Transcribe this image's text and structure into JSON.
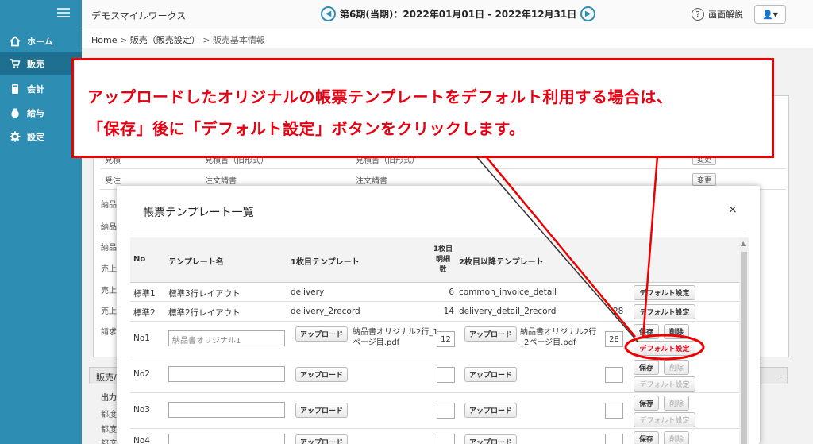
{
  "app": {
    "company": "デモスマイルワークス",
    "period": "第6期(当期)：2022年01月01日 - 2022年12月31日",
    "help_label": "画面解説"
  },
  "sidebar": {
    "items": [
      {
        "label": "ホーム",
        "icon": "home-icon"
      },
      {
        "label": "販売",
        "icon": "cart-icon",
        "active": true
      },
      {
        "label": "会計",
        "icon": "calculator-icon"
      },
      {
        "label": "給与",
        "icon": "money-bag-icon"
      },
      {
        "label": "設定",
        "icon": "gear-icon"
      }
    ]
  },
  "breadcrumb": {
    "home": "Home",
    "parent": "販売（販売設定）",
    "current": "販売基本情報"
  },
  "background": {
    "rows": [
      {
        "left": "見積",
        "mid": "見積書（旧形式）",
        "right": "見積書（旧形式）"
      },
      {
        "left": "受注",
        "mid": "注文請書",
        "right": "注文請書"
      }
    ],
    "row_side_labels": [
      "納品",
      "納品",
      "納品",
      "売上",
      "売上",
      "売上",
      "請求"
    ],
    "change_label": "変更",
    "section_title": "販売/仕入",
    "section_sub": "出力",
    "section_rows": [
      "都度",
      "都度",
      "都度"
    ],
    "collapse": "－"
  },
  "modal": {
    "title": "帳票テンプレート一覧",
    "close": "×",
    "headers": {
      "no": "No",
      "name": "テンプレート名",
      "first": "1枚目テンプレート",
      "detail_count": "1枚目明細数",
      "second": "2枚目以降テンプレート"
    },
    "rows": [
      {
        "no": "標準1",
        "name": "標準3行レイアウト",
        "first": "delivery",
        "count": "6",
        "second": "common_invoice_detail",
        "count2": "",
        "default_label": "デフォルト設定"
      },
      {
        "no": "標準2",
        "name": "標準2行レイアウト",
        "first": "delivery_2record",
        "count": "14",
        "second": "delivery_detail_2record",
        "count2": "28",
        "default_label": "デフォルト設定"
      }
    ],
    "custom_rows": [
      {
        "no": "No1",
        "name_value": "納品書オリジナル1",
        "first_file": "納品書オリジナル2行_1ページ目.pdf",
        "count": "12",
        "second_file": "納品書オリジナル2行_2ページ目.pdf",
        "count2": "28"
      },
      {
        "no": "No2"
      },
      {
        "no": "No3"
      },
      {
        "no": "No4"
      }
    ],
    "upload_label": "アップロード",
    "save_label": "保存",
    "delete_label": "削除",
    "default_label": "デフォルト設定"
  },
  "callout": {
    "line1": "アップロードしたオリジナルの帳票テンプレートをデフォルト利用する場合は、",
    "line2": "「保存」後に「デフォルト設定」ボタンをクリックします。"
  },
  "colors": {
    "sidebar": "#2d8db3",
    "accent_red": "#e60012"
  }
}
